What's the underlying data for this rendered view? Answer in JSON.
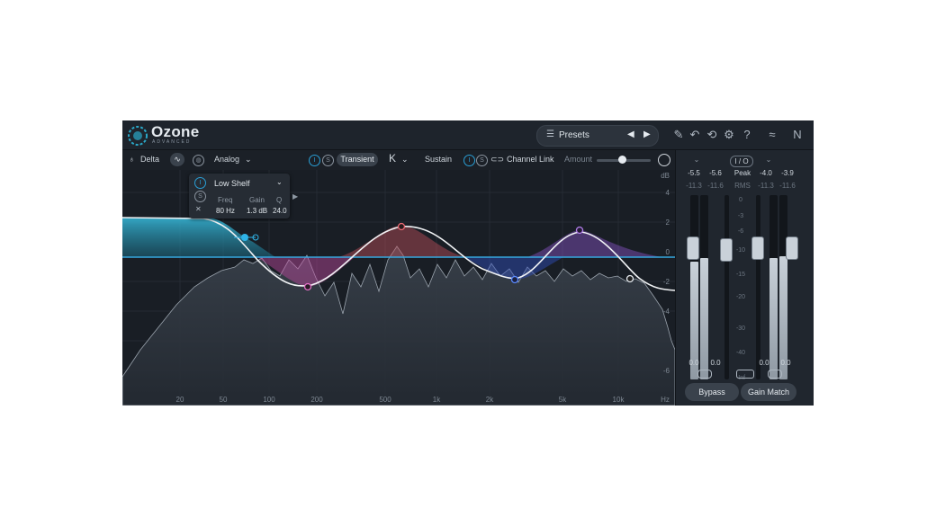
{
  "app": {
    "name": "Ozone",
    "subtitle": "ADVANCED"
  },
  "presets": {
    "icon": "list-icon",
    "label": "Presets",
    "prev": "◀",
    "next": "▶"
  },
  "toolbar": {
    "delta_label": "Delta",
    "analog_label": "Analog",
    "transient_label": "Transient",
    "sustain_label": "Sustain",
    "channel_link_label": "Channel Link",
    "amount_label": "Amount"
  },
  "popup": {
    "band_type": "Low Shelf",
    "headers": {
      "freq": "Freq",
      "gain": "Gain",
      "q": "Q"
    },
    "values": {
      "freq": "80 Hz",
      "gain": "1.3 dB",
      "q": "24.0"
    }
  },
  "graph": {
    "db_unit": "dB",
    "db_ticks": [
      "4",
      "2",
      "0",
      "-2",
      "-4",
      "-6"
    ],
    "freq_labels": [
      "20",
      "50",
      "100",
      "200",
      "500",
      "1k",
      "2k",
      "5k",
      "10k",
      "Hz"
    ]
  },
  "meter": {
    "io_label": "I / O",
    "in_values": [
      "-5.5",
      "-5.6"
    ],
    "out_values": [
      "-4.0",
      "-3.9"
    ],
    "in_rms": [
      "-11.3",
      "-11.6"
    ],
    "out_rms": [
      "-11.3",
      "-11.6"
    ],
    "peak_label": "Peak",
    "rms_label": "RMS",
    "scale": [
      "0",
      "-3",
      "-6",
      "-10",
      "-15",
      "-20",
      "-30",
      "-40",
      "-Inf"
    ],
    "in_gain": [
      "0.0",
      "0.0"
    ],
    "out_gain": [
      "0.0",
      "0.0"
    ],
    "bypass_label": "Bypass",
    "gain_match_label": "Gain Match"
  },
  "colors": {
    "accent": "#2a9fd6",
    "red_band": "#c0505a",
    "purple_band": "#8a55c8",
    "teal_band": "#2aa8c8",
    "pink_band": "#c04aa0"
  }
}
